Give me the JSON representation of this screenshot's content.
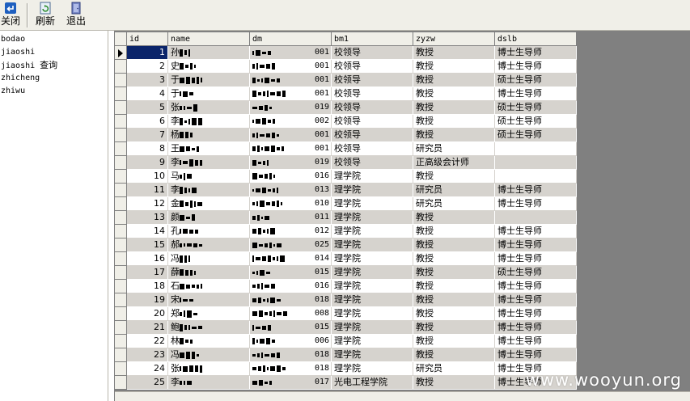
{
  "toolbar": {
    "close_label": "关闭",
    "refresh_label": "刷新",
    "exit_label": "退出"
  },
  "table_list": {
    "items": [
      {
        "name": "bodao",
        "suffix": ""
      },
      {
        "name": "jiaoshi",
        "suffix": ""
      },
      {
        "name": "jiaoshi ",
        "suffix": "查询"
      },
      {
        "name": "zhicheng",
        "suffix": ""
      },
      {
        "name": "zhiwu",
        "suffix": ""
      }
    ]
  },
  "grid": {
    "columns": [
      "id",
      "name",
      "dm",
      "bm1",
      "zyzw",
      "dslb"
    ],
    "rows": [
      {
        "id": "1",
        "name": "孙",
        "dm": "001",
        "bm1": "校领导",
        "zyzw": "教授",
        "dslb": "博士生导师"
      },
      {
        "id": "2",
        "name": "史",
        "dm": "001",
        "bm1": "校领导",
        "zyzw": "教授",
        "dslb": "博士生导师"
      },
      {
        "id": "3",
        "name": "于",
        "dm": "001",
        "bm1": "校领导",
        "zyzw": "教授",
        "dslb": "硕士生导师"
      },
      {
        "id": "4",
        "name": "于",
        "dm": "001",
        "bm1": "校领导",
        "zyzw": "教授",
        "dslb": "博士生导师"
      },
      {
        "id": "5",
        "name": "张",
        "dm": "019",
        "bm1": "校领导",
        "zyzw": "教授",
        "dslb": "硕士生导师"
      },
      {
        "id": "6",
        "name": "李",
        "dm": "002",
        "bm1": "校领导",
        "zyzw": "教授",
        "dslb": "硕士生导师"
      },
      {
        "id": "7",
        "name": "杨",
        "dm": "001",
        "bm1": "校领导",
        "zyzw": "教授",
        "dslb": "硕士生导师"
      },
      {
        "id": "8",
        "name": "王",
        "dm": "001",
        "bm1": "校领导",
        "zyzw": "研究员",
        "dslb": ""
      },
      {
        "id": "9",
        "name": "李",
        "dm": "019",
        "bm1": "校领导",
        "zyzw": "正高级会计师",
        "dslb": ""
      },
      {
        "id": "10",
        "name": "马",
        "dm": "016",
        "bm1": "理学院",
        "zyzw": "教授",
        "dslb": ""
      },
      {
        "id": "11",
        "name": "李",
        "dm": "013",
        "bm1": "理学院",
        "zyzw": "研究员",
        "dslb": "博士生导师"
      },
      {
        "id": "12",
        "name": "金",
        "dm": "010",
        "bm1": "理学院",
        "zyzw": "研究员",
        "dslb": "博士生导师"
      },
      {
        "id": "13",
        "name": "颜",
        "dm": "011",
        "bm1": "理学院",
        "zyzw": "教授",
        "dslb": ""
      },
      {
        "id": "14",
        "name": "孔",
        "dm": "012",
        "bm1": "理学院",
        "zyzw": "教授",
        "dslb": "博士生导师"
      },
      {
        "id": "15",
        "name": "郝",
        "dm": "025",
        "bm1": "理学院",
        "zyzw": "教授",
        "dslb": "博士生导师"
      },
      {
        "id": "16",
        "name": "冯",
        "dm": "014",
        "bm1": "理学院",
        "zyzw": "教授",
        "dslb": "博士生导师"
      },
      {
        "id": "17",
        "name": "薛",
        "dm": "015",
        "bm1": "理学院",
        "zyzw": "教授",
        "dslb": "硕士生导师"
      },
      {
        "id": "18",
        "name": "石",
        "dm": "016",
        "bm1": "理学院",
        "zyzw": "教授",
        "dslb": "博士生导师"
      },
      {
        "id": "19",
        "name": "宋",
        "dm": "018",
        "bm1": "理学院",
        "zyzw": "教授",
        "dslb": "博士生导师"
      },
      {
        "id": "20",
        "name": "郑",
        "dm": "008",
        "bm1": "理学院",
        "zyzw": "教授",
        "dslb": "博士生导师"
      },
      {
        "id": "21",
        "name": "鲍",
        "dm": "015",
        "bm1": "理学院",
        "zyzw": "教授",
        "dslb": "博士生导师"
      },
      {
        "id": "22",
        "name": "林",
        "dm": "006",
        "bm1": "理学院",
        "zyzw": "教授",
        "dslb": "博士生导师"
      },
      {
        "id": "23",
        "name": "冯",
        "dm": "018",
        "bm1": "理学院",
        "zyzw": "教授",
        "dslb": "博士生导师"
      },
      {
        "id": "24",
        "name": "张",
        "dm": "018",
        "bm1": "理学院",
        "zyzw": "研究员",
        "dslb": "博士生导师"
      },
      {
        "id": "25",
        "name": "李",
        "dm": "017",
        "bm1": "光电工程学院",
        "zyzw": "教授",
        "dslb": "博士生导师"
      }
    ]
  },
  "watermark": "www.wooyun.org",
  "colors": {
    "row_alt": "#d6d3ce",
    "selection": "#0a246a",
    "toolbar_bg": "#f0efe8"
  }
}
